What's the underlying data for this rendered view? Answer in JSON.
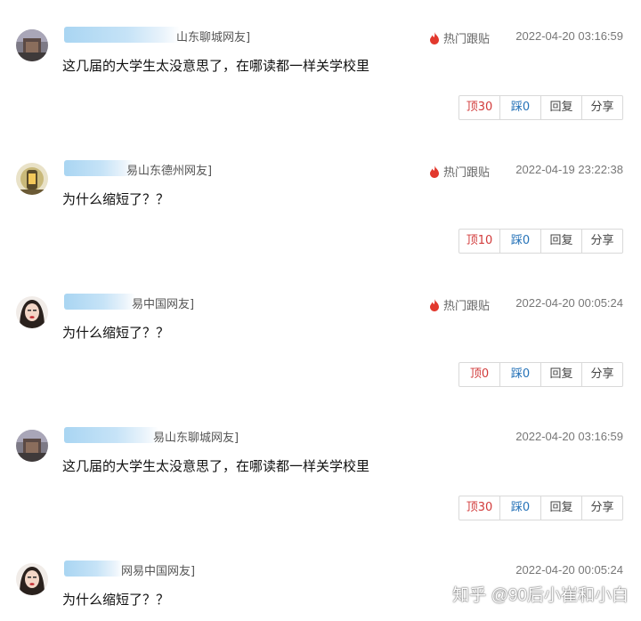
{
  "hot_label": "热门跟贴",
  "buttons": {
    "reply": "回复",
    "share": "分享"
  },
  "comments": [
    {
      "user": "山东聊城网友]",
      "show_hot": true,
      "time": "2022-04-20 03:16:59",
      "text": "这几届的大学生太没意思了，在哪读都一样关学校里",
      "up": "顶30",
      "down": "踩0"
    },
    {
      "user": "易山东德州网友]",
      "show_hot": true,
      "time": "2022-04-19 23:22:38",
      "text": "为什么缩短了？？",
      "up": "顶10",
      "down": "踩0"
    },
    {
      "user": "易中国网友]",
      "show_hot": true,
      "time": "2022-04-20 00:05:24",
      "text": "为什么缩短了？？",
      "up": "顶0",
      "down": "踩0"
    },
    {
      "user": "易山东聊城网友]",
      "show_hot": false,
      "time": "2022-04-20 03:16:59",
      "text": "这几届的大学生太没意思了，在哪读都一样关学校里",
      "up": "顶30",
      "down": "踩0"
    },
    {
      "user": "网易中国网友]",
      "show_hot": false,
      "time": "2022-04-20 00:05:24",
      "text": "为什么缩短了？？"
    }
  ],
  "watermark": "知乎 @90后小崔和小白",
  "colors": {
    "up": "#d23b3b",
    "down": "#2673b8",
    "hot_icon": "#e2382d"
  }
}
